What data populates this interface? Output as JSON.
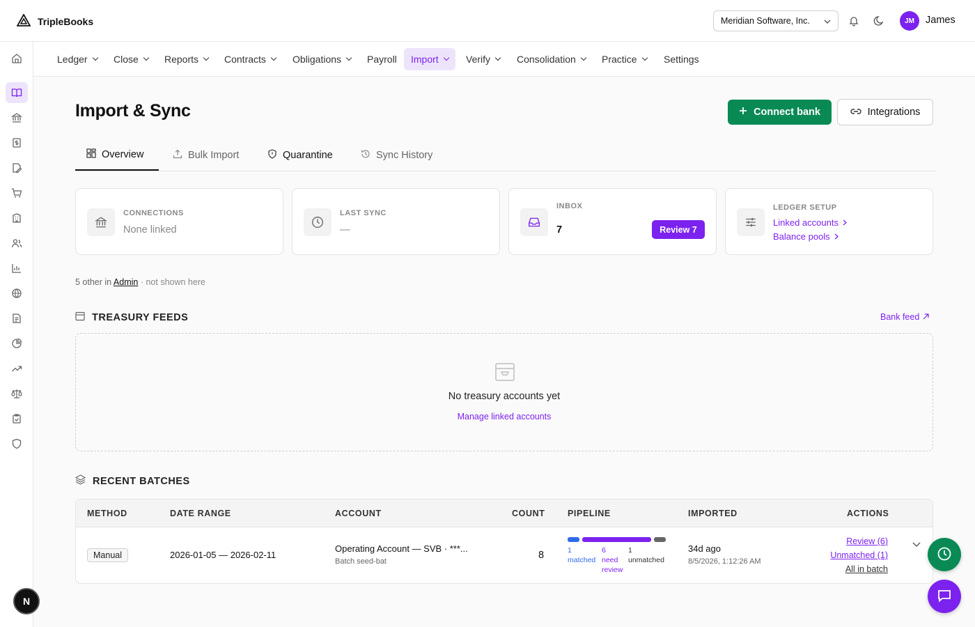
{
  "app": {
    "name": "TripleBooks",
    "org": "Meridian Software, Inc.",
    "user_initials": "JM",
    "user_name": "James",
    "rail_avatar": "N"
  },
  "nav": {
    "items": [
      {
        "label": "Ledger",
        "dropdown": true
      },
      {
        "label": "Close",
        "dropdown": true
      },
      {
        "label": "Reports",
        "dropdown": true
      },
      {
        "label": "Contracts",
        "dropdown": true
      },
      {
        "label": "Obligations",
        "dropdown": true
      },
      {
        "label": "Payroll",
        "dropdown": false
      },
      {
        "label": "Import",
        "dropdown": true,
        "active": true
      },
      {
        "label": "Verify",
        "dropdown": true
      },
      {
        "label": "Consolidation",
        "dropdown": true
      },
      {
        "label": "Practice",
        "dropdown": true
      },
      {
        "label": "Settings",
        "dropdown": false
      }
    ]
  },
  "page": {
    "title": "Import & Sync",
    "connect_label": "Connect bank",
    "integrations_label": "Integrations"
  },
  "tabs": [
    {
      "label": "Overview",
      "icon": "grid-icon"
    },
    {
      "label": "Bulk Import",
      "icon": "upload-icon"
    },
    {
      "label": "Quarantine",
      "icon": "shield-icon"
    },
    {
      "label": "Sync History",
      "icon": "history-icon"
    }
  ],
  "cards": {
    "connections": {
      "label": "CONNECTIONS",
      "value": "None linked"
    },
    "last_sync": {
      "label": "LAST SYNC",
      "value": "—"
    },
    "inbox": {
      "label": "INBOX",
      "value": "7",
      "button": "Review 7"
    },
    "ledger_setup": {
      "label": "LEDGER SETUP",
      "link1": "Linked accounts",
      "link2": "Balance pools"
    }
  },
  "other_note": {
    "prefix": "5 other in",
    "link": "Admin",
    "suffix": "· not shown here"
  },
  "treasury": {
    "heading": "TREASURY FEEDS",
    "bank_feed": "Bank feed",
    "empty_text": "No treasury accounts yet",
    "empty_link": "Manage linked accounts"
  },
  "batches": {
    "heading": "RECENT BATCHES",
    "columns": [
      "METHOD",
      "DATE RANGE",
      "ACCOUNT",
      "COUNT",
      "PIPELINE",
      "IMPORTED",
      "ACTIONS"
    ],
    "rows": [
      {
        "method": "Manual",
        "date_range": "2026-01-05 — 2026-02-11",
        "account": "Operating Account — SVB · ***...",
        "batch": "Batch seed-bat",
        "count": "8",
        "pipeline": {
          "matched": 1,
          "need_review": 6,
          "unmatched": 1,
          "matched_label": [
            "1",
            "matched"
          ],
          "review_label": [
            "6",
            "need",
            "review"
          ],
          "unmatched_label": [
            "1",
            "unmatched"
          ]
        },
        "imported_rel": "34d ago",
        "imported_abs": "8/5/2026, 1:12:26 AM",
        "actions": [
          "Review (6)",
          "Unmatched (1)",
          "All in batch"
        ]
      }
    ]
  },
  "colors": {
    "accent": "#7c22ef",
    "green": "#098a55",
    "matched": "#2f6bea",
    "unmatched": "#666666"
  }
}
